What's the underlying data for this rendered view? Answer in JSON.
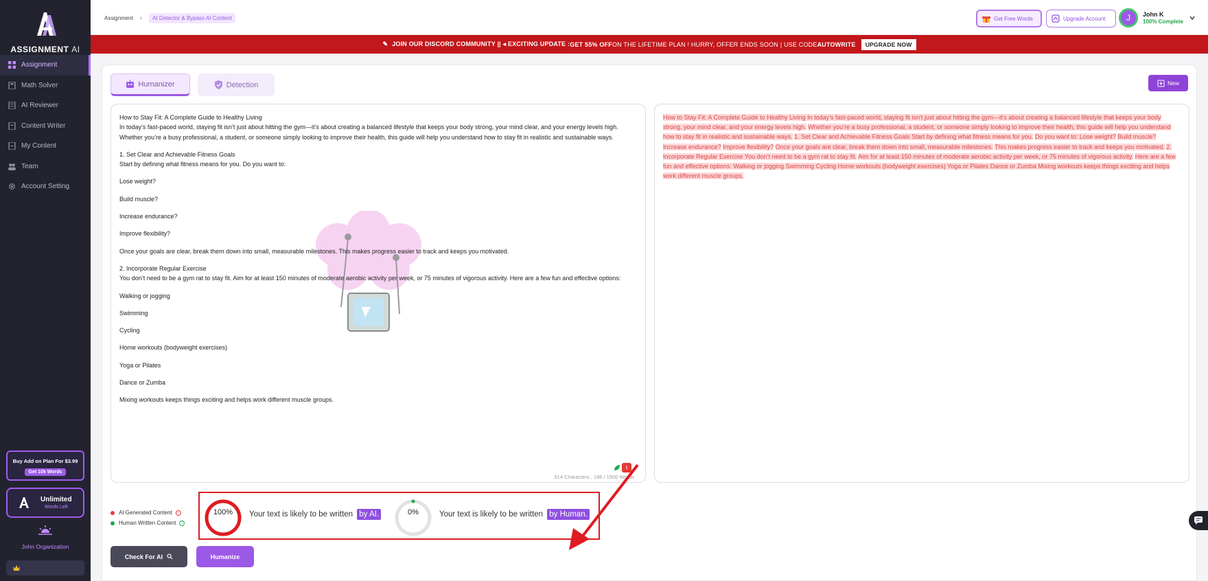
{
  "brand": {
    "name": "ASSIGNMENT",
    "suffix": "AI"
  },
  "sidebar": {
    "items": [
      {
        "label": "Assignment",
        "icon": "grid-icon",
        "active": true
      },
      {
        "label": "Math Solver",
        "icon": "calculator-icon"
      },
      {
        "label": "AI Reviewer",
        "icon": "document-icon"
      },
      {
        "label": "Content Writer",
        "icon": "page-icon"
      },
      {
        "label": "My Content",
        "icon": "folder-icon"
      },
      {
        "label": "Team",
        "icon": "team-icon"
      },
      {
        "label": "Account Setting",
        "icon": "gear-icon"
      }
    ],
    "promo": {
      "title": "Buy Add on Plan For $3.99",
      "button": "Get 10k Words"
    },
    "plan": {
      "title": "Unlimited",
      "subtitle": "Words Left"
    },
    "organization": "John Organization"
  },
  "header": {
    "breadcrumb": [
      "Assignment",
      "AI Detector & Bypass AI Content"
    ],
    "free_words_label": "Get Free Words",
    "upgrade_label": "Upgrade Account",
    "user": {
      "initial": "J",
      "name": "John K",
      "status": "100% Complete"
    }
  },
  "banner": {
    "text_a": "JOIN OUR DISCORD COMMUNITY || ◂ EXCITING UPDATE : ",
    "text_b": "GET 55% OFF",
    "text_c": " ON THE LIFETIME PLAN ! HURRY, OFFER ENDS SOON | USE CODE ",
    "code": "AUTOWRITE",
    "button": "UPGRADE NOW"
  },
  "tabs": {
    "humanizer": "Humanizer",
    "detection": "Detection",
    "new_button": "New"
  },
  "editor": {
    "paragraphs": [
      "How to Stay Fit: A Complete Guide to Healthy Living\nIn today’s fast-paced world, staying fit isn’t just about hitting the gym—it’s about creating a balanced lifestyle that keeps your body strong, your mind clear, and your energy levels high. Whether you’re a busy professional, a student, or someone simply looking to improve their health, this guide will help you understand how to stay fit in realistic and sustainable ways.",
      "1. Set Clear and Achievable Fitness Goals\nStart by defining what fitness means for you. Do you want to:",
      "Lose weight?",
      "Build muscle?",
      "Increase endurance?",
      "Improve flexibility?",
      "Once your goals are clear, break them down into small, measurable milestones. This makes progress easier to track and keeps you motivated.",
      "2. Incorporate Regular Exercise\nYou don’t need to be a gym rat to stay fit. Aim for at least 150 minutes of moderate aerobic activity per week, or 75 minutes of vigorous activity. Here are a few fun and effective options:",
      "Walking or jogging",
      "Swimming",
      "Cycling",
      "Home workouts (bodyweight exercises)",
      "Yoga or Pilates",
      "Dance or Zumba",
      "Mixing workouts keeps things exciting and helps work different muscle groups."
    ],
    "char_count": "914 Characters , 186 / 1500 Words",
    "badge": "1"
  },
  "output": {
    "sentences": [
      "How to Stay Fit: A Complete Guide to Healthy Living In today’s fast-paced world, staying fit isn’t just about hitting the gym—it’s about creating a balanced lifestyle that keeps your body strong, your mind clear, and your energy levels high.",
      "Whether you’re a busy professional, a student, or someone simply looking to improve their health, this guide will help you understand how to stay fit in realistic and sustainable ways.",
      "1. Set Clear and Achievable Fitness Goals Start by defining what fitness means for you.",
      "Do you want to: Lose weight?",
      "Build muscle?",
      "Increase endurance?",
      "Improve flexibility?",
      "Once your goals are clear, break them down into small, measurable milestones.",
      "This makes progress easier to track and keeps you motivated.",
      "2. Incorporate Regular Exercise You don’t need to be a gym rat to stay fit.",
      "Aim for at least 150 minutes of moderate aerobic activity per week, or 75 minutes of vigorous activity.",
      "Here are a few fun and effective options: Walking or jogging Swimming Cycling Home workouts (bodyweight exercises) Yoga or Pilates Dance or Zumba Mixing workouts keeps things exciting and helps work different muscle groups."
    ]
  },
  "legend": {
    "ai": "AI Generated Content",
    "human": "Human Written Content"
  },
  "scores": {
    "ai": {
      "value": "100%",
      "fraction": 1.0,
      "text": "Your text is likely to be written ",
      "tag": "by AI."
    },
    "human": {
      "value": "0%",
      "fraction": 0.0,
      "text": "Your text is likely to be written ",
      "tag": "by Human."
    }
  },
  "actions": {
    "check": "Check For AI",
    "humanize": "Humanize"
  },
  "colors": {
    "accent": "#9b59e6",
    "sidebar": "#23232f",
    "banner": "#c2171b",
    "ai": "#e53935",
    "human": "#21a84a"
  }
}
